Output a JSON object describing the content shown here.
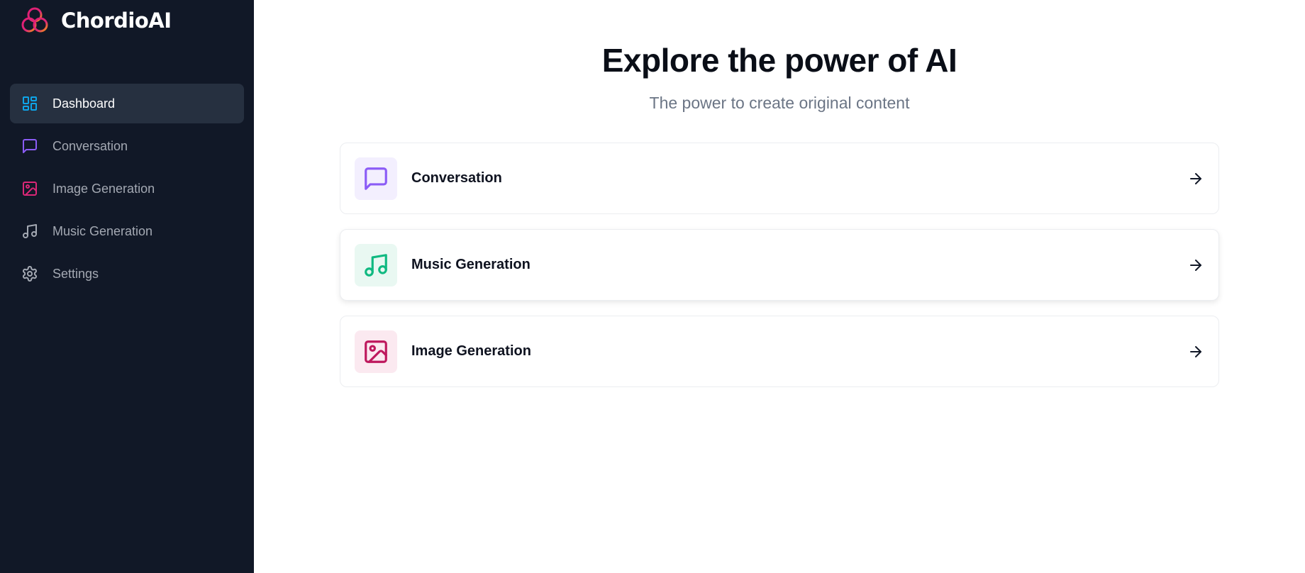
{
  "brand": {
    "name": "ChordioAI",
    "logo_icon": "chordio-logo-icon"
  },
  "sidebar": {
    "items": [
      {
        "label": "Dashboard",
        "icon": "dashboard-icon",
        "color": "#0ea5e9",
        "active": true
      },
      {
        "label": "Conversation",
        "icon": "message-square-icon",
        "color": "#8b5cf6",
        "active": false
      },
      {
        "label": "Image Generation",
        "icon": "image-icon",
        "color": "#db2777",
        "active": false
      },
      {
        "label": "Music Generation",
        "icon": "music-icon",
        "color": "#a4a9b3",
        "active": false
      },
      {
        "label": "Settings",
        "icon": "gear-icon",
        "color": "#a4a9b3",
        "active": false
      }
    ]
  },
  "main": {
    "title": "Explore the power of AI",
    "subtitle": "The power to create original content",
    "cards": [
      {
        "label": "Conversation",
        "icon": "message-square-icon",
        "color": "#8b5cf6",
        "bg": "#f3effe"
      },
      {
        "label": "Music Generation",
        "icon": "music-icon",
        "color": "#10b981",
        "bg": "#e9f8f2"
      },
      {
        "label": "Image Generation",
        "icon": "image-icon",
        "color": "#be185d",
        "bg": "#fbe9f0"
      }
    ]
  },
  "colors": {
    "sidebar_bg": "#111827",
    "active_item_bg": "#263040"
  }
}
